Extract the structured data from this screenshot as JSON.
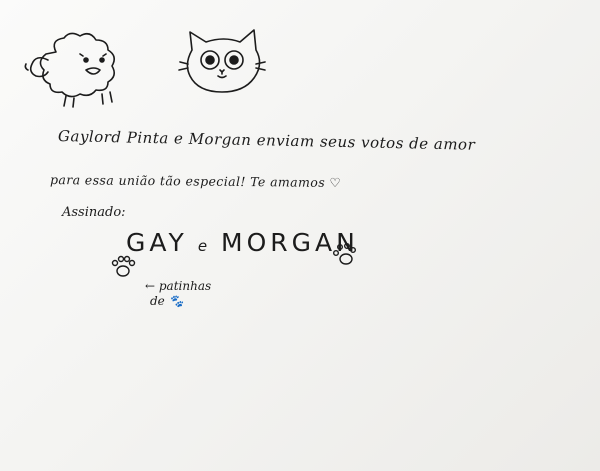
{
  "message": {
    "line1": "Gaylord Pinta e Morgan enviam seus votos de amor",
    "line2": "para essa união tão especial! Te amamos ♡",
    "signed_label": "Assinado:",
    "sign_name_1": "GAY",
    "sign_and": "e",
    "sign_name_2": "MORGAN",
    "paw_note_1": "← patinhas",
    "paw_note_2": "de 🐾"
  },
  "icons": [
    "sheep-drawing-icon",
    "cat-drawing-icon",
    "heart-icon",
    "paw-print-icon"
  ],
  "colors": {
    "ink": "#1c1c1c",
    "paper": "#f7f7f5"
  }
}
